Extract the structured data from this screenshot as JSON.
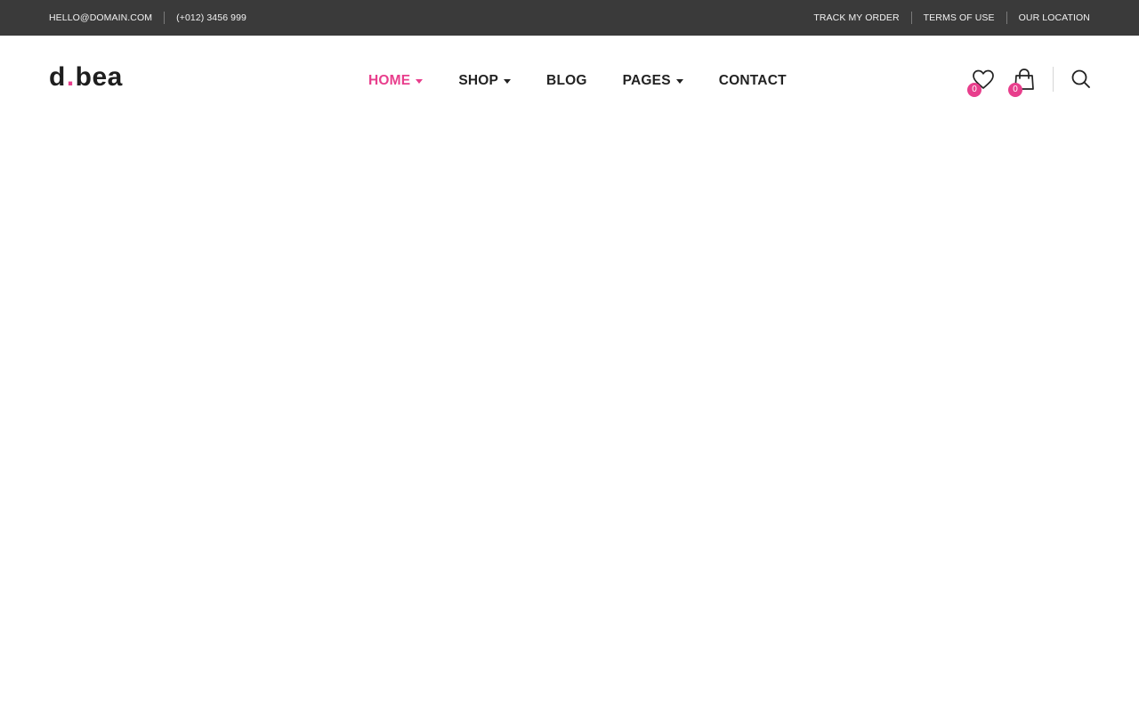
{
  "topbar": {
    "email": "HELLO@DOMAIN.COM",
    "phone": "(+012) 3456 999",
    "links": [
      "TRACK MY ORDER",
      "TERMS OF USE",
      "OUR LOCATION"
    ]
  },
  "header": {
    "logo": {
      "part1": "d",
      "dot": ".",
      "part2": "bea"
    },
    "nav": [
      {
        "label": "HOME",
        "dropdown": true,
        "active": true
      },
      {
        "label": "SHOP",
        "dropdown": true,
        "active": false
      },
      {
        "label": "BLOG",
        "dropdown": false,
        "active": false
      },
      {
        "label": "PAGES",
        "dropdown": true,
        "active": false
      },
      {
        "label": "CONTACT",
        "dropdown": false,
        "active": false
      }
    ],
    "wishlist": {
      "icon": "heart-icon",
      "count": "0"
    },
    "cart": {
      "icon": "shopping-bag-icon",
      "count": "0"
    },
    "search": {
      "icon": "search-icon"
    }
  },
  "colors": {
    "accent": "#e83e8c",
    "topbar_bg": "#3a3a3a",
    "text_dark": "#222222"
  }
}
